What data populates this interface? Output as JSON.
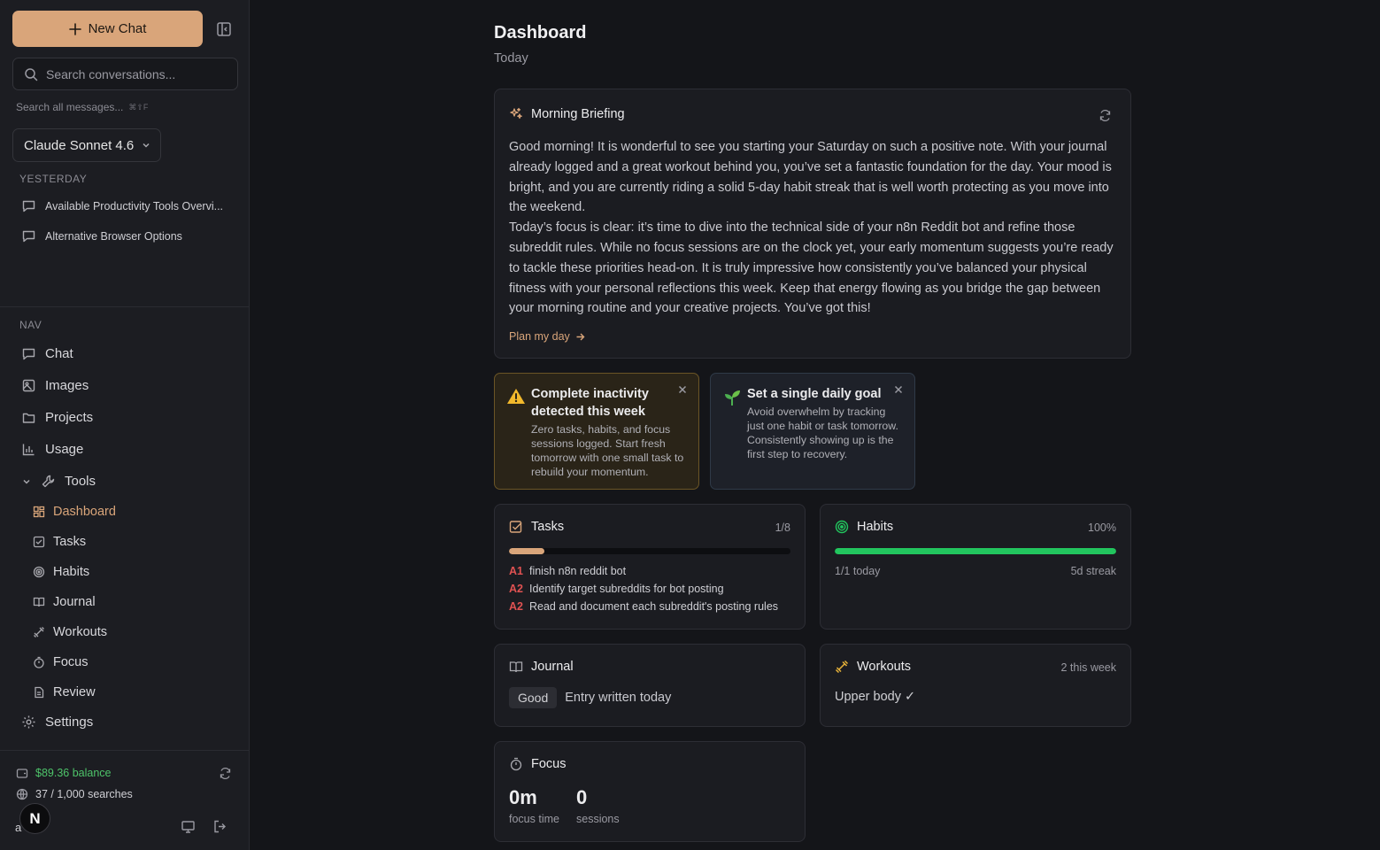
{
  "sidebar": {
    "new_chat": "New Chat",
    "search_placeholder": "Search conversations...",
    "search_all": "Search all messages...",
    "search_all_shortcut": "⌘⇧F",
    "model": "Claude Sonnet 4.6",
    "section_yesterday": "YESTERDAY",
    "conversations": [
      {
        "title": "Available Productivity Tools Overvi..."
      },
      {
        "title": "Alternative Browser Options"
      }
    ],
    "nav_label": "NAV",
    "nav": {
      "chat": "Chat",
      "images": "Images",
      "projects": "Projects",
      "usage": "Usage",
      "tools": "Tools",
      "dashboard": "Dashboard",
      "tasks": "Tasks",
      "habits": "Habits",
      "journal": "Journal",
      "workouts": "Workouts",
      "focus": "Focus",
      "review": "Review",
      "settings": "Settings"
    },
    "balance": "$89.36 balance",
    "searches": "37 / 1,000 searches",
    "avatar_letter": "N",
    "avatar_under": "a"
  },
  "main": {
    "title": "Dashboard",
    "subtitle": "Today",
    "briefing": {
      "title": "Morning Briefing",
      "paragraphs": [
        "Good morning! It is wonderful to see you starting your Saturday on such a positive note. With your journal already logged and a great workout behind you, you’ve set a fantastic foundation for the day. Your mood is bright, and you are currently riding a solid 5-day habit streak that is well worth protecting as you move into the weekend.",
        "Today’s focus is clear: it’s time to dive into the technical side of your n8n Reddit bot and refine those subreddit rules. While no focus sessions are on the clock yet, your early momentum suggests you’re ready to tackle these priorities head-on. It is truly impressive how consistently you’ve balanced your physical fitness with your personal reflections this week. Keep that energy flowing as you bridge the gap between your morning routine and your creative projects. You’ve got this!"
      ],
      "plan_link": "Plan my day"
    },
    "alerts": [
      {
        "title": "Complete inactivity detected this week",
        "body": "Zero tasks, habits, and focus sessions logged. Start fresh tomorrow with one small task to rebuild your momentum."
      },
      {
        "title": "Set a single daily goal",
        "body": "Avoid overwhelm by tracking just one habit or task tomorrow. Consistently showing up is the first step to recovery."
      }
    ],
    "tasks": {
      "title": "Tasks",
      "count": "1/8",
      "progress": 0.125,
      "items": [
        {
          "priority": "A1",
          "text": "finish n8n reddit bot"
        },
        {
          "priority": "A2",
          "text": "Identify target subreddits for bot posting"
        },
        {
          "priority": "A2",
          "text": "Read and document each subreddit's posting rules"
        }
      ]
    },
    "habits": {
      "title": "Habits",
      "percent": "100%",
      "progress": 1.0,
      "today": "1/1 today",
      "streak": "5d streak"
    },
    "journal": {
      "title": "Journal",
      "mood": "Good",
      "status": "Entry written today"
    },
    "workouts": {
      "title": "Workouts",
      "count": "2 this week",
      "entry": "Upper body ✓"
    },
    "focus": {
      "title": "Focus",
      "time": "0m",
      "time_label": "focus time",
      "sessions": "0",
      "sessions_label": "sessions"
    }
  },
  "colors": {
    "accent": "#d9a57a",
    "success": "#22c55e",
    "priority": "#e05252",
    "background": "#141519"
  }
}
